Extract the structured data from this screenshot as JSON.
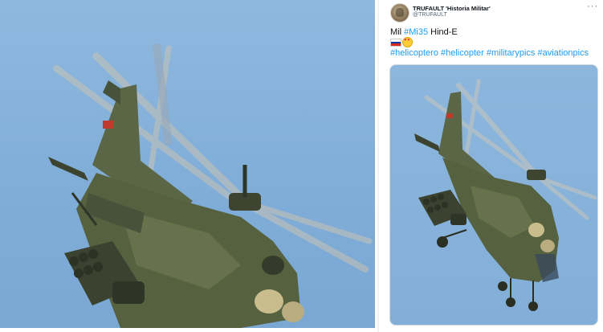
{
  "tweet": {
    "display_name": "TRUFAULT 'Historia Militar'",
    "handle": "@TRUFAULT",
    "more_label": "···",
    "text_prefix": "Mil ",
    "text_hashtag": "#Mi35",
    "text_suffix": " Hind-E",
    "emojis": [
      "flag-russia",
      "smiling-face-with-heart-eyes"
    ],
    "hashtags": [
      "#helicoptero",
      "#helicopter",
      "#militarypics",
      "#aviationpics"
    ]
  },
  "colors": {
    "hashtag": "#1d9bf0",
    "sky": "#85b1da",
    "camo": "#4f5b3a"
  },
  "images": {
    "left_photo": "helicopter-closeup-photo",
    "right_photo": "helicopter-full-photo"
  }
}
